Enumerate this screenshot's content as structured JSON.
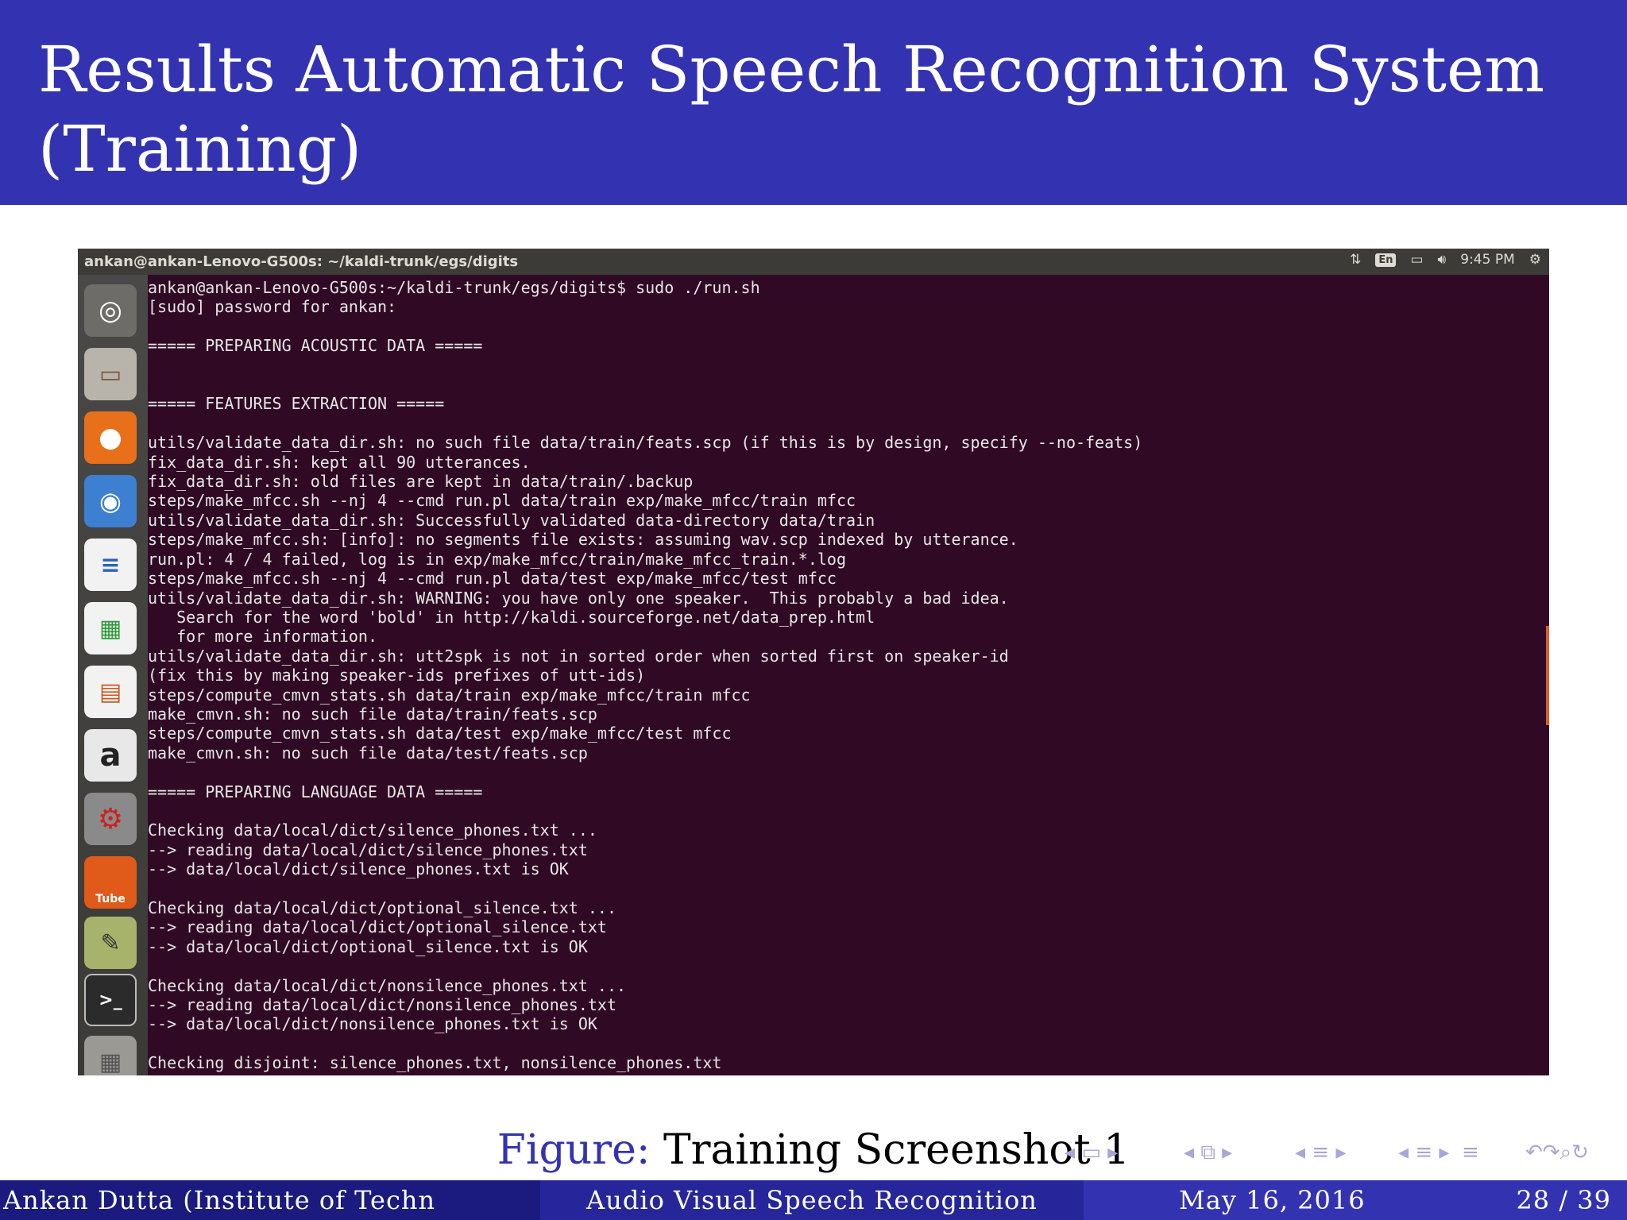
{
  "slide": {
    "title": "Results Automatic Speech Recognition System (Training)"
  },
  "screenshot": {
    "window_title": "ankan@ankan-Lenovo-G500s: ~/kaldi-trunk/egs/digits",
    "indicators": {
      "keyboard": "En",
      "time": "9:45 PM"
    },
    "launcher": [
      {
        "name": "ubuntu-dash-icon"
      },
      {
        "name": "files-icon"
      },
      {
        "name": "firefox-icon"
      },
      {
        "name": "chromium-icon"
      },
      {
        "name": "libreoffice-writer-icon"
      },
      {
        "name": "libreoffice-calc-icon"
      },
      {
        "name": "libreoffice-impress-icon"
      },
      {
        "name": "amazon-icon",
        "text": "a"
      },
      {
        "name": "system-settings-icon"
      },
      {
        "name": "minitube-icon",
        "text": "Tube"
      },
      {
        "name": "text-editor-icon"
      },
      {
        "name": "terminal-icon",
        "text": ">_"
      },
      {
        "name": "workspace-switcher-icon"
      }
    ],
    "terminal_lines": [
      "ankan@ankan-Lenovo-G500s:~/kaldi-trunk/egs/digits$ sudo ./run.sh",
      "[sudo] password for ankan:",
      "",
      "===== PREPARING ACOUSTIC DATA =====",
      "",
      "",
      "===== FEATURES EXTRACTION =====",
      "",
      "utils/validate_data_dir.sh: no such file data/train/feats.scp (if this is by design, specify --no-feats)",
      "fix_data_dir.sh: kept all 90 utterances.",
      "fix_data_dir.sh: old files are kept in data/train/.backup",
      "steps/make_mfcc.sh --nj 4 --cmd run.pl data/train exp/make_mfcc/train mfcc",
      "utils/validate_data_dir.sh: Successfully validated data-directory data/train",
      "steps/make_mfcc.sh: [info]: no segments file exists: assuming wav.scp indexed by utterance.",
      "run.pl: 4 / 4 failed, log is in exp/make_mfcc/train/make_mfcc_train.*.log",
      "steps/make_mfcc.sh --nj 4 --cmd run.pl data/test exp/make_mfcc/test mfcc",
      "utils/validate_data_dir.sh: WARNING: you have only one speaker.  This probably a bad idea.",
      "   Search for the word 'bold' in http://kaldi.sourceforge.net/data_prep.html",
      "   for more information.",
      "utils/validate_data_dir.sh: utt2spk is not in sorted order when sorted first on speaker-id",
      "(fix this by making speaker-ids prefixes of utt-ids)",
      "steps/compute_cmvn_stats.sh data/train exp/make_mfcc/train mfcc",
      "make_cmvn.sh: no such file data/train/feats.scp",
      "steps/compute_cmvn_stats.sh data/test exp/make_mfcc/test mfcc",
      "make_cmvn.sh: no such file data/test/feats.scp",
      "",
      "===== PREPARING LANGUAGE DATA =====",
      "",
      "Checking data/local/dict/silence_phones.txt ...",
      "--> reading data/local/dict/silence_phones.txt",
      "--> data/local/dict/silence_phones.txt is OK",
      "",
      "Checking data/local/dict/optional_silence.txt ...",
      "--> reading data/local/dict/optional_silence.txt",
      "--> data/local/dict/optional_silence.txt is OK",
      "",
      "Checking data/local/dict/nonsilence_phones.txt ...",
      "--> reading data/local/dict/nonsilence_phones.txt",
      "--> data/local/dict/nonsilence_phones.txt is OK",
      "",
      "Checking disjoint: silence_phones.txt, nonsilence_phones.txt"
    ]
  },
  "caption": {
    "label": "Figure:",
    "text": "Training Screenshot 1"
  },
  "footer": {
    "author": "Ankan Dutta (Institute of Techn",
    "title": "Audio Visual Speech Recognition",
    "date": "May 16, 2016",
    "page": "28 / 39"
  },
  "colors": {
    "beamer_blue": "#3333b2",
    "terminal_bg": "#300a24",
    "panel_bg": "#3c3b37"
  }
}
